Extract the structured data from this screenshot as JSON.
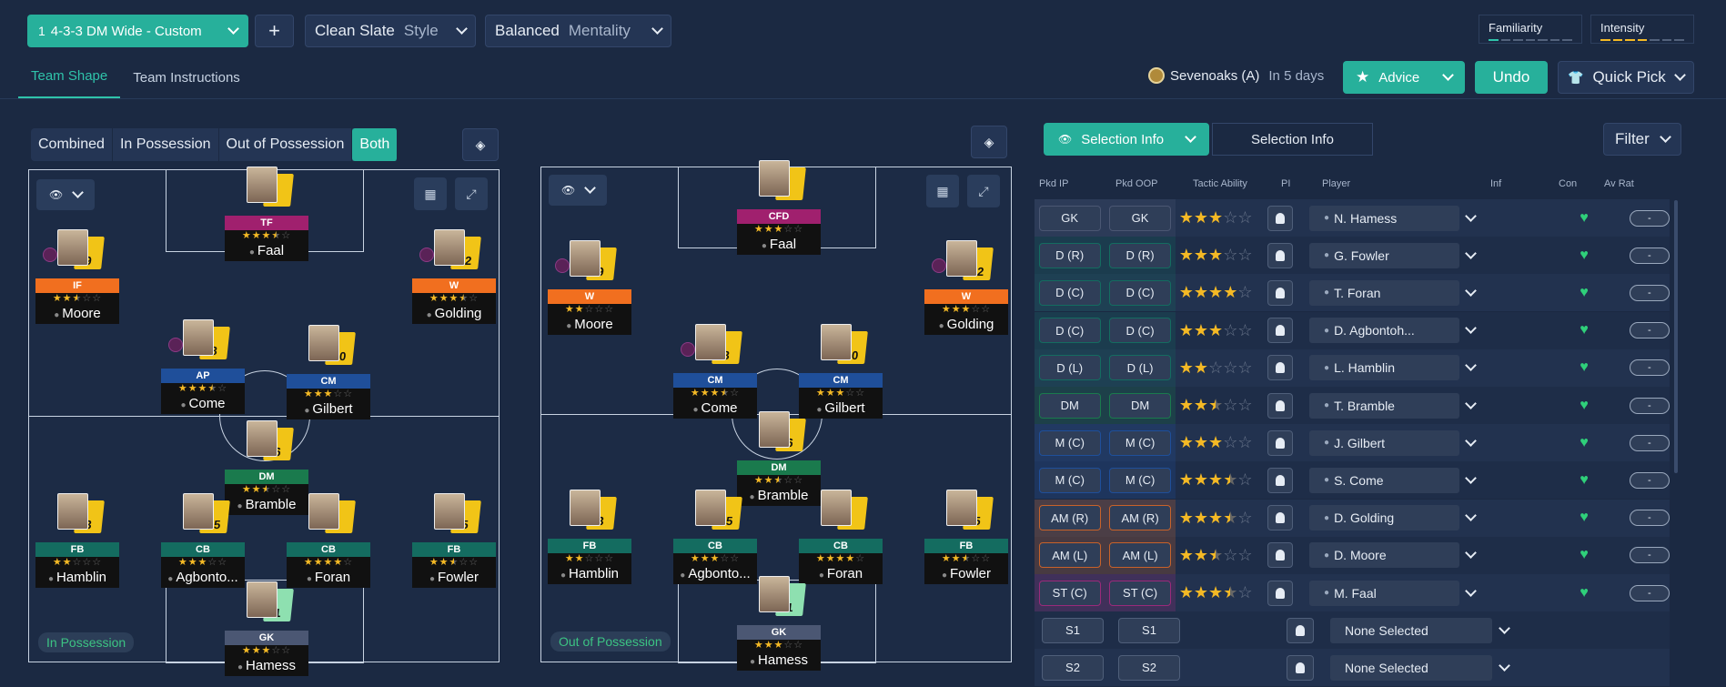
{
  "topbar": {
    "formation": {
      "number": "1",
      "label": "4-3-3 DM Wide - Custom"
    },
    "add": "+",
    "style": {
      "value": "Clean Slate",
      "label": "Style"
    },
    "mentality": {
      "value": "Balanced",
      "label": "Mentality"
    },
    "familiarity": "Familiarity",
    "intensity": "Intensity"
  },
  "tabs": [
    "Team Shape",
    "Team Instructions"
  ],
  "match": {
    "opponent": "Sevenoaks (A)",
    "when": "In 5 days"
  },
  "actions": {
    "advice": "Advice",
    "undo": "Undo",
    "quick_pick": "Quick Pick"
  },
  "view_modes": [
    "Combined",
    "In Possession",
    "Out of Possession",
    "Both"
  ],
  "pitch_ip": {
    "label": "In Possession",
    "players": [
      {
        "role": "TF",
        "name": "Faal",
        "num": "",
        "stars": 3.5,
        "color": "#a0206e"
      },
      {
        "role": "IF",
        "name": "Moore",
        "num": "9",
        "stars": 2.5,
        "color": "#f16f1f"
      },
      {
        "role": "W",
        "name": "Golding",
        "num": "12",
        "stars": 3.5,
        "color": "#f16f1f"
      },
      {
        "role": "AP",
        "name": "Come",
        "num": "8",
        "stars": 3.5,
        "color": "#1f4f9a"
      },
      {
        "role": "CM",
        "name": "Gilbert",
        "num": "10",
        "stars": 3,
        "color": "#1f4f9a"
      },
      {
        "role": "DM",
        "name": "Bramble",
        "num": "6",
        "stars": 2.5,
        "color": "#1a7a4d"
      },
      {
        "role": "FB",
        "name": "Hamblin",
        "num": "3",
        "stars": 2,
        "color": "#146c60"
      },
      {
        "role": "CB",
        "name": "Agbonto...",
        "num": "15",
        "stars": 3,
        "color": "#146c60"
      },
      {
        "role": "CB",
        "name": "Foran",
        "num": "",
        "stars": 4,
        "color": "#146c60"
      },
      {
        "role": "FB",
        "name": "Fowler",
        "num": "5",
        "stars": 2.5,
        "color": "#146c60"
      },
      {
        "role": "GK",
        "name": "Hamess",
        "num": "1",
        "stars": 3,
        "color": "#4b5773"
      }
    ]
  },
  "pitch_oop": {
    "label": "Out of Possession",
    "players": [
      {
        "role": "CFD",
        "name": "Faal",
        "num": "",
        "stars": 3,
        "color": "#a0206e"
      },
      {
        "role": "W",
        "name": "Moore",
        "num": "9",
        "stars": 2,
        "color": "#f16f1f"
      },
      {
        "role": "W",
        "name": "Golding",
        "num": "12",
        "stars": 3,
        "color": "#f16f1f"
      },
      {
        "role": "CM",
        "name": "Come",
        "num": "8",
        "stars": 3.5,
        "color": "#1f4f9a"
      },
      {
        "role": "CM",
        "name": "Gilbert",
        "num": "10",
        "stars": 3,
        "color": "#1f4f9a"
      },
      {
        "role": "DM",
        "name": "Bramble",
        "num": "6",
        "stars": 2.5,
        "color": "#1a7a4d"
      },
      {
        "role": "FB",
        "name": "Hamblin",
        "num": "3",
        "stars": 2,
        "color": "#146c60"
      },
      {
        "role": "CB",
        "name": "Agbonto...",
        "num": "15",
        "stars": 3,
        "color": "#146c60"
      },
      {
        "role": "CB",
        "name": "Foran",
        "num": "",
        "stars": 4,
        "color": "#146c60"
      },
      {
        "role": "FB",
        "name": "Fowler",
        "num": "5",
        "stars": 2.5,
        "color": "#146c60"
      },
      {
        "role": "GK",
        "name": "Hamess",
        "num": "1",
        "stars": 3,
        "color": "#4b5773"
      }
    ]
  },
  "selection": {
    "dropdown": "Selection Info",
    "tab": "Selection Info",
    "filter": "Filter",
    "headers": [
      "Pkd IP",
      "Pkd OOP",
      "Tactic Ability",
      "PI",
      "Player",
      "Inf",
      "Con",
      "Av Rat"
    ],
    "rows": [
      {
        "ip": "GK",
        "oop": "GK",
        "stars": 3,
        "player": "N. Hamess",
        "rat": "-",
        "color": "#4b5773"
      },
      {
        "ip": "D (R)",
        "oop": "D (R)",
        "stars": 3,
        "player": "G. Fowler",
        "rat": "-",
        "color": "#146c60"
      },
      {
        "ip": "D (C)",
        "oop": "D (C)",
        "stars": 4,
        "player": "T. Foran",
        "rat": "-",
        "color": "#146c60"
      },
      {
        "ip": "D (C)",
        "oop": "D (C)",
        "stars": 3,
        "player": "D. Agbontoh...",
        "rat": "-",
        "color": "#146c60"
      },
      {
        "ip": "D (L)",
        "oop": "D (L)",
        "stars": 2,
        "player": "L. Hamblin",
        "rat": "-",
        "color": "#146c60"
      },
      {
        "ip": "DM",
        "oop": "DM",
        "stars": 2.5,
        "player": "T. Bramble",
        "rat": "-",
        "color": "#1a7a4d"
      },
      {
        "ip": "M (C)",
        "oop": "M (C)",
        "stars": 3,
        "player": "J. Gilbert",
        "rat": "-",
        "color": "#1f4f9a"
      },
      {
        "ip": "M (C)",
        "oop": "M (C)",
        "stars": 3.5,
        "player": "S. Come",
        "rat": "-",
        "color": "#1f4f9a"
      },
      {
        "ip": "AM (R)",
        "oop": "AM (R)",
        "stars": 3.5,
        "player": "D. Golding",
        "rat": "-",
        "color": "#c8622a"
      },
      {
        "ip": "AM (L)",
        "oop": "AM (L)",
        "stars": 2.5,
        "player": "D. Moore",
        "rat": "-",
        "color": "#c8622a"
      },
      {
        "ip": "ST (C)",
        "oop": "ST (C)",
        "stars": 3.5,
        "player": "M. Faal",
        "rat": "-",
        "color": "#9a2a7a"
      },
      {
        "ip": "S1",
        "oop": "S1",
        "stars": 0,
        "player": "None Selected",
        "rat": "",
        "color": ""
      },
      {
        "ip": "S2",
        "oop": "S2",
        "stars": 0,
        "player": "None Selected",
        "rat": "",
        "color": ""
      }
    ]
  }
}
